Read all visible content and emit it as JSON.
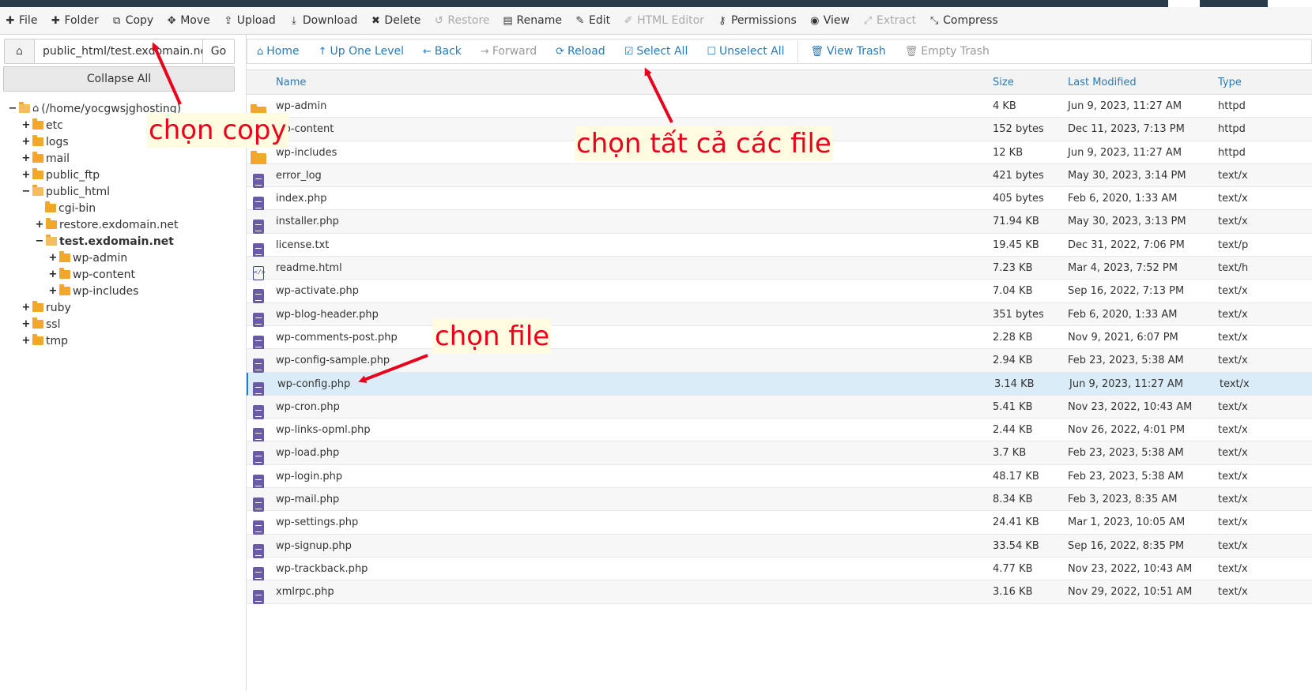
{
  "toolbar": {
    "file": "File",
    "folder": "Folder",
    "copy": "Copy",
    "move": "Move",
    "upload": "Upload",
    "download": "Download",
    "delete": "Delete",
    "restore": "Restore",
    "rename": "Rename",
    "edit": "Edit",
    "html_editor": "HTML Editor",
    "permissions": "Permissions",
    "view": "View",
    "extract": "Extract",
    "compress": "Compress"
  },
  "sidebar": {
    "path_value": "public_html/test.exdomain.net",
    "go_label": "Go",
    "collapse_label": "Collapse All",
    "tree": {
      "root": "(/home/yocgwsjghosting)",
      "etc": "etc",
      "logs": "logs",
      "mail": "mail",
      "public_ftp": "public_ftp",
      "public_html": "public_html",
      "cgi_bin": "cgi-bin",
      "restore": "restore.exdomain.net",
      "test": "test.exdomain.net",
      "wp_admin": "wp-admin",
      "wp_content": "wp-content",
      "wp_includes": "wp-includes",
      "ruby": "ruby",
      "ssl": "ssl",
      "tmp": "tmp"
    }
  },
  "nav": {
    "home": "Home",
    "up": "Up One Level",
    "back": "Back",
    "forward": "Forward",
    "reload": "Reload",
    "select_all": "Select All",
    "unselect_all": "Unselect All",
    "view_trash": "View Trash",
    "empty_trash": "Empty Trash"
  },
  "table": {
    "headers": {
      "name": "Name",
      "size": "Size",
      "modified": "Last Modified",
      "type": "Type"
    },
    "rows": [
      {
        "name": "wp-admin",
        "size": "4 KB",
        "modified": "Jun 9, 2023, 11:27 AM",
        "type": "httpd",
        "kind": "folder"
      },
      {
        "name": "wp-content",
        "size": "152 bytes",
        "modified": "Dec 11, 2023, 7:13 PM",
        "type": "httpd",
        "kind": "folder"
      },
      {
        "name": "wp-includes",
        "size": "12 KB",
        "modified": "Jun 9, 2023, 11:27 AM",
        "type": "httpd",
        "kind": "folder"
      },
      {
        "name": "error_log",
        "size": "421 bytes",
        "modified": "May 30, 2023, 3:14 PM",
        "type": "text/x",
        "kind": "file"
      },
      {
        "name": "index.php",
        "size": "405 bytes",
        "modified": "Feb 6, 2020, 1:33 AM",
        "type": "text/x",
        "kind": "file"
      },
      {
        "name": "installer.php",
        "size": "71.94 KB",
        "modified": "May 30, 2023, 3:13 PM",
        "type": "text/x",
        "kind": "file"
      },
      {
        "name": "license.txt",
        "size": "19.45 KB",
        "modified": "Dec 31, 2022, 7:06 PM",
        "type": "text/p",
        "kind": "file"
      },
      {
        "name": "readme.html",
        "size": "7.23 KB",
        "modified": "Mar 4, 2023, 7:52 PM",
        "type": "text/h",
        "kind": "html"
      },
      {
        "name": "wp-activate.php",
        "size": "7.04 KB",
        "modified": "Sep 16, 2022, 7:13 PM",
        "type": "text/x",
        "kind": "file"
      },
      {
        "name": "wp-blog-header.php",
        "size": "351 bytes",
        "modified": "Feb 6, 2020, 1:33 AM",
        "type": "text/x",
        "kind": "file"
      },
      {
        "name": "wp-comments-post.php",
        "size": "2.28 KB",
        "modified": "Nov 9, 2021, 6:07 PM",
        "type": "text/x",
        "kind": "file"
      },
      {
        "name": "wp-config-sample.php",
        "size": "2.94 KB",
        "modified": "Feb 23, 2023, 5:38 AM",
        "type": "text/x",
        "kind": "file"
      },
      {
        "name": "wp-config.php",
        "size": "3.14 KB",
        "modified": "Jun 9, 2023, 11:27 AM",
        "type": "text/x",
        "kind": "file",
        "selected": true
      },
      {
        "name": "wp-cron.php",
        "size": "5.41 KB",
        "modified": "Nov 23, 2022, 10:43 AM",
        "type": "text/x",
        "kind": "file"
      },
      {
        "name": "wp-links-opml.php",
        "size": "2.44 KB",
        "modified": "Nov 26, 2022, 4:01 PM",
        "type": "text/x",
        "kind": "file"
      },
      {
        "name": "wp-load.php",
        "size": "3.7 KB",
        "modified": "Feb 23, 2023, 5:38 AM",
        "type": "text/x",
        "kind": "file"
      },
      {
        "name": "wp-login.php",
        "size": "48.17 KB",
        "modified": "Feb 23, 2023, 5:38 AM",
        "type": "text/x",
        "kind": "file"
      },
      {
        "name": "wp-mail.php",
        "size": "8.34 KB",
        "modified": "Feb 3, 2023, 8:35 AM",
        "type": "text/x",
        "kind": "file"
      },
      {
        "name": "wp-settings.php",
        "size": "24.41 KB",
        "modified": "Mar 1, 2023, 10:05 AM",
        "type": "text/x",
        "kind": "file"
      },
      {
        "name": "wp-signup.php",
        "size": "33.54 KB",
        "modified": "Sep 16, 2022, 8:35 PM",
        "type": "text/x",
        "kind": "file"
      },
      {
        "name": "wp-trackback.php",
        "size": "4.77 KB",
        "modified": "Nov 23, 2022, 10:43 AM",
        "type": "text/x",
        "kind": "file"
      },
      {
        "name": "xmlrpc.php",
        "size": "3.16 KB",
        "modified": "Nov 29, 2022, 10:51 AM",
        "type": "text/x",
        "kind": "file"
      }
    ]
  },
  "annotations": {
    "copy": "chọn copy",
    "select_all": "chọn tất cả các file",
    "file": "chọn file"
  },
  "colors": {
    "accent": "#2a7ab8",
    "annotation": "#e8001c",
    "folder": "#f0a72b",
    "file": "#6b5aa6",
    "selected_row": "#d9ecf7"
  }
}
